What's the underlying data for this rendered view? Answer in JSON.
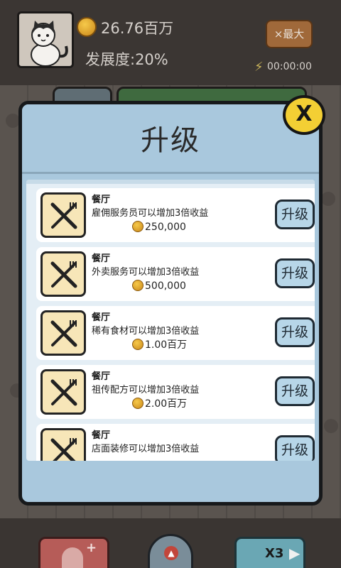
{
  "hud": {
    "money": "26.76百万",
    "progress": "发展度:20%",
    "max_label": "×最大",
    "timer": "00:00:00"
  },
  "dialog": {
    "title": "升级",
    "close_label": "X",
    "rows": [
      {
        "category": "餐厅",
        "description": "雇佣服务员可以增加3倍收益",
        "cost": "250,000",
        "button": "升级"
      },
      {
        "category": "餐厅",
        "description": "外卖服务可以增加3倍收益",
        "cost": "500,000",
        "button": "升级"
      },
      {
        "category": "餐厅",
        "description": "稀有食材可以增加3倍收益",
        "cost": "1.00百万",
        "button": "升级"
      },
      {
        "category": "餐厅",
        "description": "祖传配方可以增加3倍收益",
        "cost": "2.00百万",
        "button": "升级"
      },
      {
        "category": "餐厅",
        "description": "店面装修可以增加3倍收益",
        "button": "升级"
      }
    ]
  },
  "toolbar": {
    "speed_label": "X3"
  },
  "colors": {
    "dialog_bg": "#a9c8dd",
    "close_button": "#f3cf34",
    "upgrade_button": "#b7d6e8",
    "icon_tile": "#f7e6b8"
  },
  "icons": {
    "row_icon": "fork-knife-icon",
    "coin": "coin-icon",
    "timer": "lightning-icon"
  }
}
